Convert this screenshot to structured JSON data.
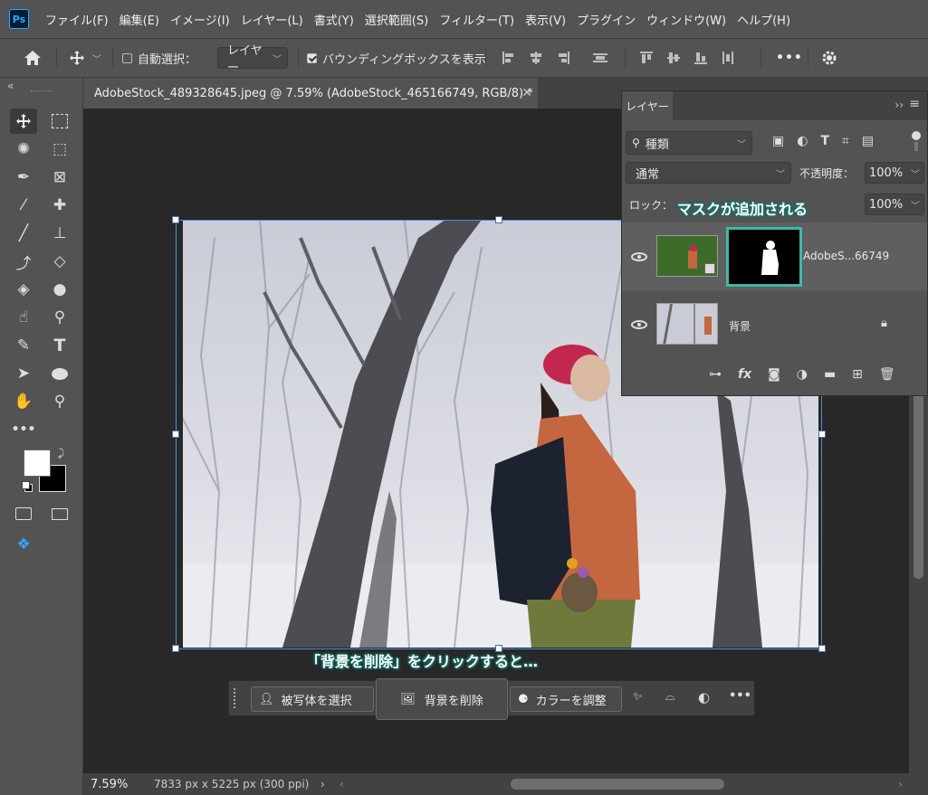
{
  "menu": {
    "logo": "Ps",
    "items": [
      "ファイル(F)",
      "編集(E)",
      "イメージ(I)",
      "レイヤー(L)",
      "書式(Y)",
      "選択範囲(S)",
      "フィルター(T)",
      "表示(V)",
      "プラグイン",
      "ウィンドウ(W)",
      "ヘルプ(H)"
    ]
  },
  "options": {
    "auto_select_label": "自動選択：",
    "auto_select_target": "レイヤー",
    "bounding_box_label": "バウンディングボックスを表示",
    "more_label": "•••"
  },
  "toolbar": {
    "collapse": "«",
    "more": "•••"
  },
  "document": {
    "tab_title": "AdobeStock_489328645.jpeg @ 7.59% (AdobeStock_465166749, RGB/8) *",
    "zoom": "7.59%",
    "dimensions": "7833 px x 5225 px (300 ppi)"
  },
  "layers_panel": {
    "title": "レイヤー",
    "filter_kind": "種類",
    "blend_mode": "通常",
    "opacity_label": "不透明度：",
    "opacity_value": "100%",
    "lock_label": "ロック：",
    "fill_value": "100%",
    "layers": [
      {
        "name": "AdobeS...66749",
        "has_mask": true
      },
      {
        "name": "背景",
        "locked": true
      }
    ],
    "mask_callout": "マスクが追加される"
  },
  "context_bar": {
    "select_subject": "被写体を選択",
    "remove_background": "背景を削除",
    "adjust_color": "カラーを調整",
    "more": "•••"
  },
  "annotations": {
    "click_callout": "「背景を削除」をクリックすると…"
  },
  "colors": {
    "accent_teal": "#3fb9a8",
    "ui_dark": "#535353",
    "canvas_bg": "#282828"
  }
}
